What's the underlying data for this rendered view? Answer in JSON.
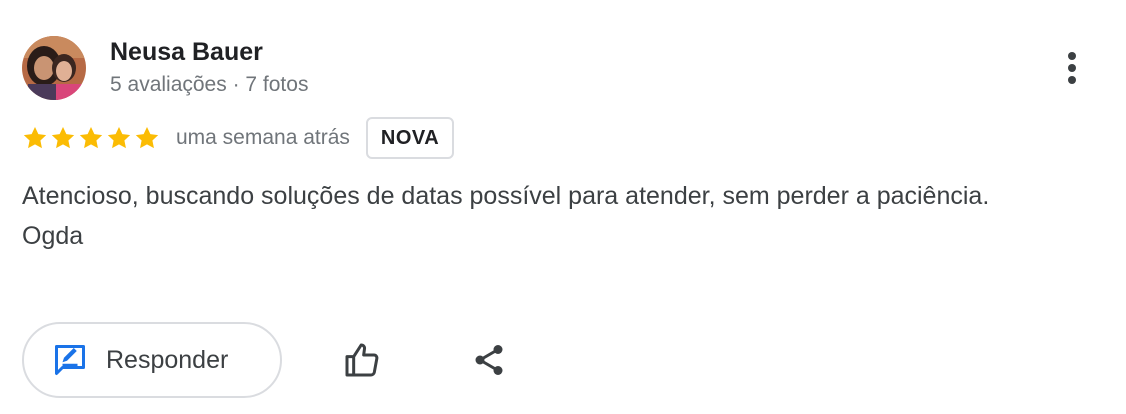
{
  "review": {
    "author": {
      "name": "Neusa Bauer",
      "meta": "5 avaliações · 7 fotos"
    },
    "rating": 5,
    "rating_max": 5,
    "time_ago": "uma semana atrás",
    "badge": "NOVA",
    "text_lines": [
      "Atencioso, buscando soluções de datas possível para atender, sem perder a paciência.",
      "Ogda"
    ],
    "actions": {
      "respond_label": "Responder"
    },
    "icons": {
      "more": "more-vert-icon",
      "respond": "reply-edit-icon",
      "like": "thumb-up-icon",
      "share": "share-icon",
      "star": "star-icon"
    },
    "colors": {
      "star": "#fbbc04",
      "accent_blue": "#1a73e8",
      "text_primary": "#202124",
      "text_secondary": "#70757a"
    }
  }
}
